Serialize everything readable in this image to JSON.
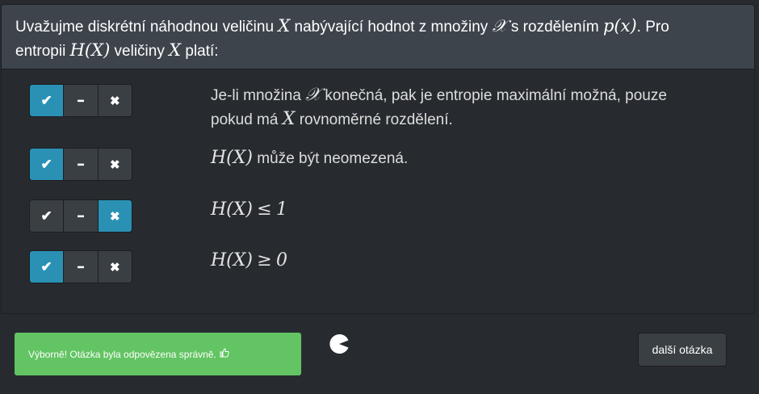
{
  "question": {
    "text_1": "Uvažujme diskrétní náhodnou veličinu",
    "var_X": "X",
    "text_2": "nabývající hodnot z množiny",
    "set_X": "𝒳",
    "text_3": "s rozdělením",
    "dist": "p(x)",
    "text_4": ". Pro",
    "text_5": "entropii",
    "entropy": "H(X)",
    "text_6": "veličiny",
    "var_X2": "X",
    "text_7": "platí:"
  },
  "answer_buttons": {
    "yes_glyph": "✔",
    "neutral_glyph": "━",
    "no_glyph": "✖"
  },
  "statements": [
    {
      "selected": "yes",
      "part_1": "Je-li množina",
      "set": "𝒳",
      "part_2": "konečná, pak je entropie maximální možná, pouze",
      "part_3": "pokud má",
      "var": "X",
      "part_4": "rovnoměrné rozdělení."
    },
    {
      "selected": "yes",
      "math": "H(X)",
      "part_1": "může být neomezená."
    },
    {
      "selected": "no",
      "math": "H(X)",
      "rel": "≤",
      "num": "1"
    },
    {
      "selected": "yes",
      "math": "H(X)",
      "rel": "≥",
      "num": "0"
    }
  ],
  "feedback": {
    "message": "Výborně! Otázka byla odpovězena správně.",
    "icon": "thumbs-up-icon",
    "color": "#62c462"
  },
  "next_button": {
    "label": "další otázka"
  },
  "colors": {
    "accent": "#2a91b5",
    "panel_heading": "#3e444c",
    "background": "#272b30"
  }
}
